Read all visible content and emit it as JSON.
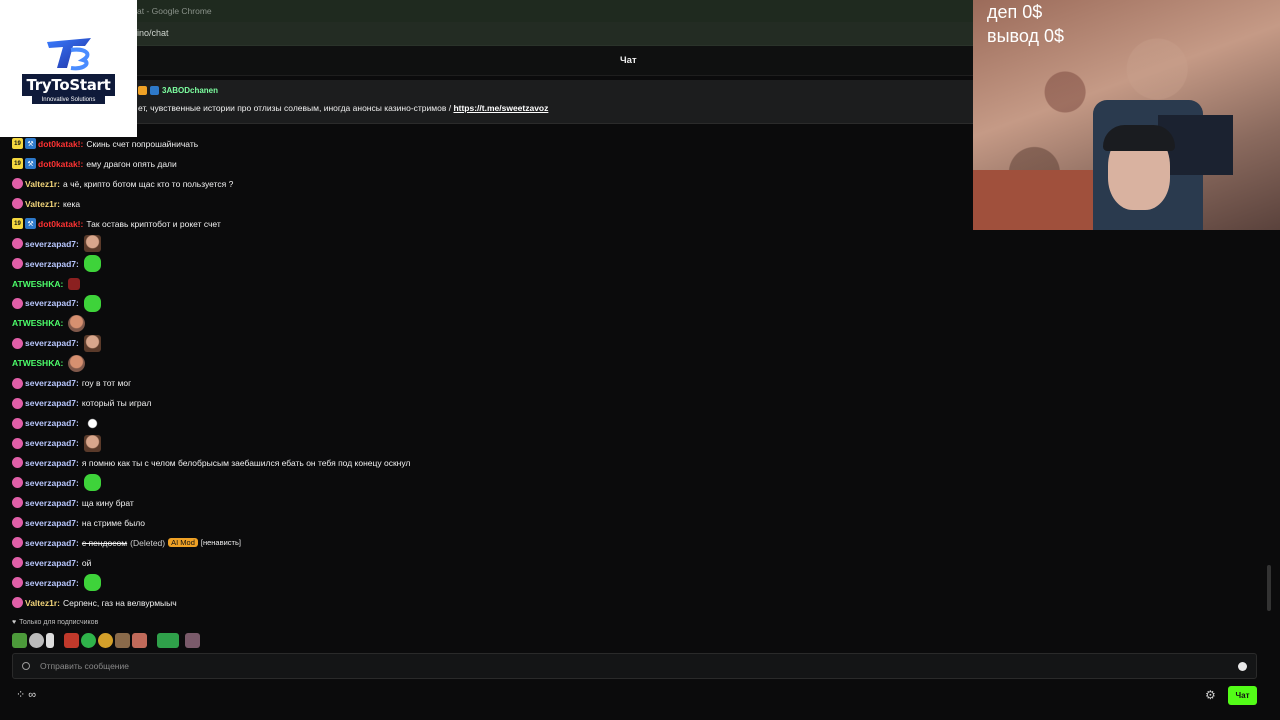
{
  "browser": {
    "title_suffix": "at - Google Chrome",
    "url": "ino/chat"
  },
  "header": {
    "title": "Чат"
  },
  "pinned": {
    "user": "3ABODchanen",
    "text": "ет, чувственные истории про отлизы солевым, иногда анонсы казино-стримов / ",
    "link": "https://t.me/sweetzavoz"
  },
  "logo": {
    "name": "TryToStart",
    "tagline": "Innovative Solutions"
  },
  "overlay": {
    "deposit": "деп 0$",
    "withdraw": "вывод 0$"
  },
  "messages": [
    {
      "user": "dot0katak!",
      "color": "red",
      "badges": [
        "19",
        "tool"
      ],
      "text": "Скинь счет попрошайничать"
    },
    {
      "user": "dot0katak!",
      "color": "red",
      "badges": [
        "19",
        "tool"
      ],
      "text": "ему драгон опять дали"
    },
    {
      "user": "Valtez1r",
      "color": "yellow",
      "badges": [
        "sub"
      ],
      "text": "а чё, крипто ботом щас кто то пользуется ?"
    },
    {
      "user": "Valtez1r",
      "color": "yellow",
      "badges": [
        "sub"
      ],
      "text": "кека"
    },
    {
      "user": "dot0katak!",
      "color": "red",
      "badges": [
        "19",
        "tool"
      ],
      "text": "Так оставь криптобот и рокет счет"
    },
    {
      "user": "severzapad7",
      "color": "blue",
      "badges": [
        "sub"
      ],
      "emote": "face"
    },
    {
      "user": "severzapad7",
      "color": "blue",
      "badges": [
        "sub"
      ],
      "emote": "pepe"
    },
    {
      "user": "ATWESHKA",
      "color": "green",
      "badges": [],
      "emote": "red"
    },
    {
      "user": "severzapad7",
      "color": "blue",
      "badges": [
        "sub"
      ],
      "emote": "pepe"
    },
    {
      "user": "ATWESHKA",
      "color": "green",
      "badges": [],
      "emote": "rock"
    },
    {
      "user": "severzapad7",
      "color": "blue",
      "badges": [
        "sub"
      ],
      "emote": "face"
    },
    {
      "user": "ATWESHKA",
      "color": "green",
      "badges": [],
      "emote": "rock"
    },
    {
      "user": "severzapad7",
      "color": "blue",
      "badges": [
        "sub"
      ],
      "text": "гоу в тот мог"
    },
    {
      "user": "severzapad7",
      "color": "blue",
      "badges": [
        "sub"
      ],
      "text": "который ты играл"
    },
    {
      "user": "severzapad7",
      "color": "blue",
      "badges": [
        "sub"
      ],
      "emote": "white"
    },
    {
      "user": "severzapad7",
      "color": "blue",
      "badges": [
        "sub"
      ],
      "emote": "face"
    },
    {
      "user": "severzapad7",
      "color": "blue",
      "badges": [
        "sub"
      ],
      "text": "я помню как ты с челом белобрысым заебашился ебать он тебя под конецу оскнул"
    },
    {
      "user": "severzapad7",
      "color": "blue",
      "badges": [
        "sub"
      ],
      "emote": "pepe"
    },
    {
      "user": "severzapad7",
      "color": "blue",
      "badges": [
        "sub"
      ],
      "text": "ща кину брат"
    },
    {
      "user": "severzapad7",
      "color": "blue",
      "badges": [
        "sub"
      ],
      "text": "на стриме было"
    },
    {
      "user": "severzapad7",
      "color": "blue",
      "badges": [
        "sub"
      ],
      "deleted_text": "с пендосом",
      "deleted_label": "(Deleted)",
      "mod_label": "AI Mod",
      "reason": "[ненависть]"
    },
    {
      "user": "severzapad7",
      "color": "blue",
      "badges": [
        "sub"
      ],
      "text": "ой"
    },
    {
      "user": "severzapad7",
      "color": "blue",
      "badges": [
        "sub"
      ],
      "emote": "pepe"
    },
    {
      "user": "Valtez1r",
      "color": "yellow",
      "badges": [
        "sub"
      ],
      "text": "Серпенс, газ на велвурмыыч"
    }
  ],
  "sub_only_label": "Только для подписчиков",
  "input": {
    "placeholder": "Отправить сообщение"
  },
  "footer": {
    "infinity": "∞",
    "send_label": "Чат"
  }
}
